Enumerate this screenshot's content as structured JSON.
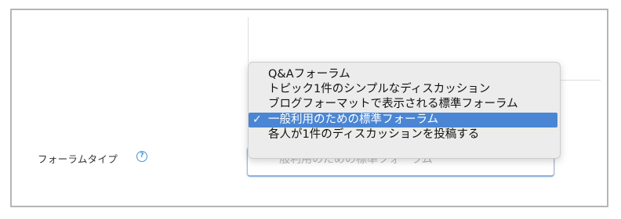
{
  "form": {
    "label": "フォーラムタイプ",
    "help_icon_glyph": "?",
    "select_value": "一般利用のための標準フォーラム"
  },
  "dropdown": {
    "check_glyph": "✓",
    "options": [
      {
        "label": "Q&Aフォーラム",
        "selected": false
      },
      {
        "label": "トピック1件のシンプルなディスカッション",
        "selected": false
      },
      {
        "label": "ブログフォーマットで表示される標準フォーラム",
        "selected": false
      },
      {
        "label": "一般利用のための標準フォーラム",
        "selected": true
      },
      {
        "label": "各人が1件のディスカッションを投稿する",
        "selected": false
      }
    ]
  },
  "colors": {
    "accent": "#4a86d4",
    "help_icon": "#4a90d9",
    "menu_background": "#ececec"
  },
  "icons": {
    "help": "question-circle-icon",
    "selected": "checkmark-icon"
  }
}
